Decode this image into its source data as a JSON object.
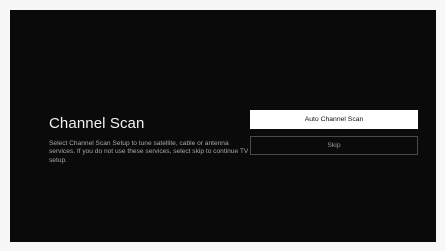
{
  "screen": {
    "title": "Channel Scan",
    "description": "Select Channel Scan Setup to tune satellite, cable or antenna services. If you do not use these services, select skip to continue TV setup."
  },
  "buttons": {
    "auto_scan_label": "Auto Channel Scan",
    "skip_label": "Skip"
  },
  "colors": {
    "background": "#0a0a0a",
    "primary_button": "#ffffff",
    "secondary_border": "#4a4a4a",
    "text": "#f2f2f2",
    "muted_text": "#a8a8a8"
  }
}
